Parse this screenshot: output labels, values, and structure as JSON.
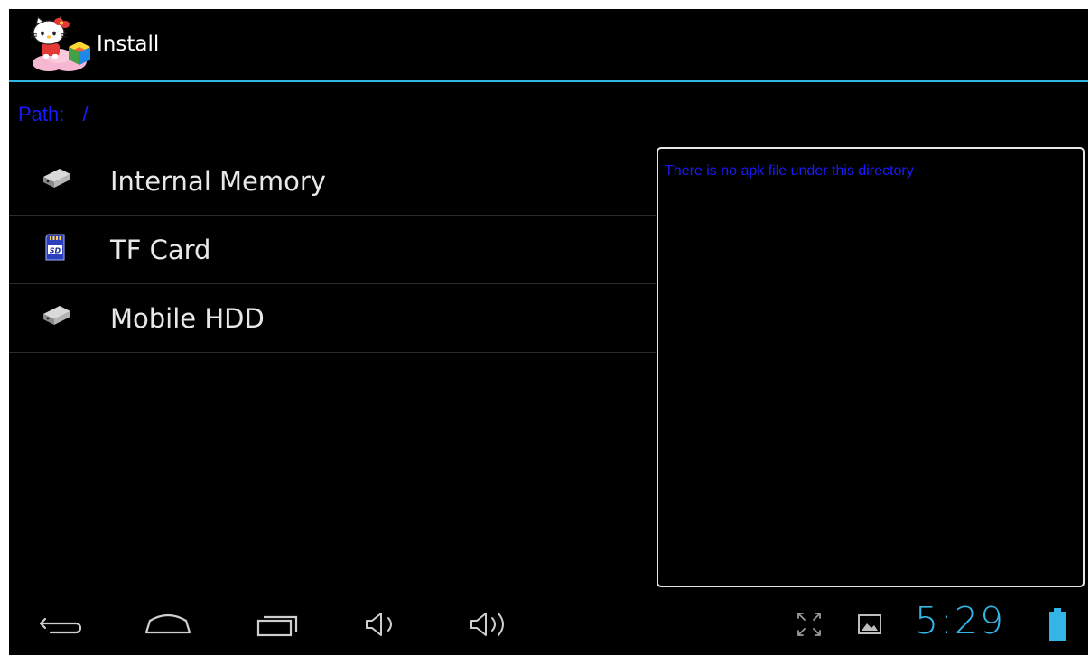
{
  "app": {
    "title": "Install"
  },
  "path": {
    "label": "Path:",
    "value": "/"
  },
  "storage": {
    "items": [
      {
        "label": "Internal Memory",
        "icon": "hard-drive-icon"
      },
      {
        "label": "TF Card",
        "icon": "sd-card-icon"
      },
      {
        "label": "Mobile HDD",
        "icon": "hard-drive-icon"
      }
    ]
  },
  "panel": {
    "message": "There is no apk file under this directory"
  },
  "status": {
    "time": "5:29",
    "battery_level": 1.0
  },
  "nav": {
    "icons": [
      "back-icon",
      "home-icon",
      "recent-apps-icon",
      "volume-down-icon",
      "volume-up-icon"
    ]
  },
  "colors": {
    "accent": "#33b5e5",
    "link_text": "#1a1aff",
    "background": "#000000"
  }
}
